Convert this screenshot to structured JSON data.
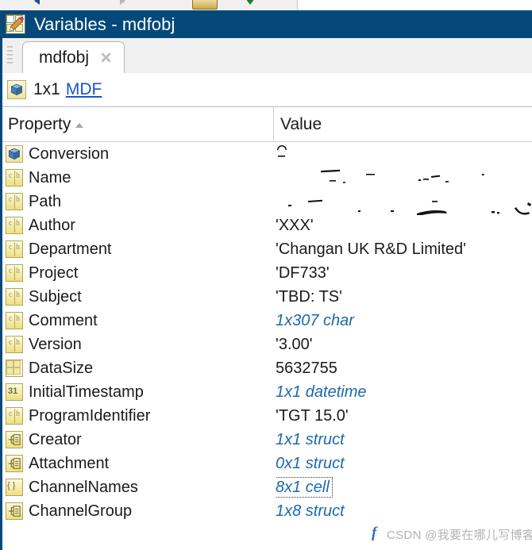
{
  "window": {
    "title": "Variables - mdfobj",
    "icon": "variables-editor-icon"
  },
  "toolbar": {
    "icons": [
      "back-arrow-icon",
      "forward-arrow-icon",
      "open-folder-icon",
      "download-arrow-icon"
    ]
  },
  "tabs": [
    {
      "label": "mdfobj",
      "active": true,
      "close_icon": "close-icon"
    }
  ],
  "summary": {
    "icon": "cube-icon",
    "dimensions": "1x1",
    "class_link": "MDF"
  },
  "table": {
    "columns": [
      {
        "label": "Property",
        "sort": "asc"
      },
      {
        "label": "Value"
      }
    ],
    "rows": [
      {
        "icon": "cube-icon",
        "name": "Conversion",
        "value": "",
        "style": "redacted"
      },
      {
        "icon": "char-icon",
        "name": "Name",
        "value": "",
        "style": "redacted"
      },
      {
        "icon": "char-icon",
        "name": "Path",
        "value": "",
        "style": "redacted"
      },
      {
        "icon": "char-icon",
        "name": "Author",
        "value": "'XXX'",
        "style": "text"
      },
      {
        "icon": "char-icon",
        "name": "Department",
        "value": "'Changan UK R&D Limited'",
        "style": "text"
      },
      {
        "icon": "char-icon",
        "name": "Project",
        "value": "'DF733'",
        "style": "text"
      },
      {
        "icon": "char-icon",
        "name": "Subject",
        "value": "'TBD: TS'",
        "style": "text"
      },
      {
        "icon": "char-icon",
        "name": "Comment",
        "value": "1x307 char",
        "style": "meta"
      },
      {
        "icon": "char-icon",
        "name": "Version",
        "value": "'3.00'",
        "style": "text"
      },
      {
        "icon": "grid-icon",
        "name": "DataSize",
        "value": "5632755",
        "style": "text"
      },
      {
        "icon": "datetime-icon",
        "name": "InitialTimestamp",
        "value": "1x1 datetime",
        "style": "meta"
      },
      {
        "icon": "char-icon",
        "name": "ProgramIdentifier",
        "value": "'TGT 15.0'",
        "style": "text"
      },
      {
        "icon": "struct-icon",
        "name": "Creator",
        "value": "1x1 struct",
        "style": "meta"
      },
      {
        "icon": "struct-icon",
        "name": "Attachment",
        "value": "0x1 struct",
        "style": "meta"
      },
      {
        "icon": "cell-icon",
        "name": "ChannelNames",
        "value": "8x1 cell",
        "style": "meta selected"
      },
      {
        "icon": "struct-icon",
        "name": "ChannelGroup",
        "value": "1x8 struct",
        "style": "meta"
      }
    ]
  },
  "watermark": {
    "mark": "f",
    "text": "CSDN @我要在哪儿写博客"
  },
  "colors": {
    "titlebar": "#04497a",
    "link": "#1a52d6",
    "meta_value": "#1a6aab",
    "text": "#1a1a1a",
    "tabbar": "#f0f0f0"
  }
}
